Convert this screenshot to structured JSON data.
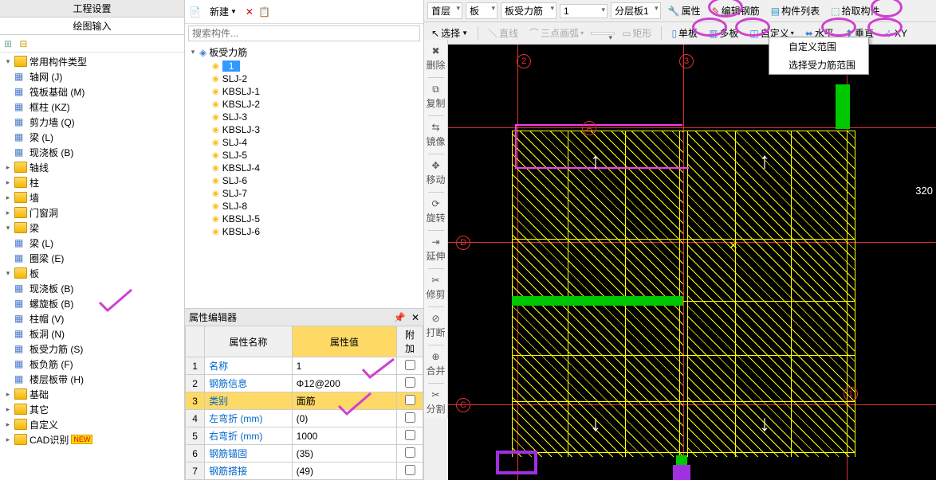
{
  "left_panel": {
    "tabs": {
      "settings": "工程设置",
      "draw": "绘图输入"
    },
    "tree": [
      {
        "label": "常用构件类型",
        "depth": 0,
        "exp": "▾",
        "icon": "folder"
      },
      {
        "label": "轴网 (J)",
        "depth": 1,
        "icon": "grid"
      },
      {
        "label": "筏板基础 (M)",
        "depth": 1,
        "icon": "grid"
      },
      {
        "label": "框柱 (KZ)",
        "depth": 1,
        "icon": "col"
      },
      {
        "label": "剪力墙 (Q)",
        "depth": 1,
        "icon": "wall"
      },
      {
        "label": "梁 (L)",
        "depth": 1,
        "icon": "beam"
      },
      {
        "label": "现浇板 (B)",
        "depth": 1,
        "icon": "slab"
      },
      {
        "label": "轴线",
        "depth": 0,
        "exp": "▸",
        "icon": "folder"
      },
      {
        "label": "柱",
        "depth": 0,
        "exp": "▸",
        "icon": "folder"
      },
      {
        "label": "墙",
        "depth": 0,
        "exp": "▸",
        "icon": "folder"
      },
      {
        "label": "门窗洞",
        "depth": 0,
        "exp": "▸",
        "icon": "folder"
      },
      {
        "label": "梁",
        "depth": 0,
        "exp": "▾",
        "icon": "folder"
      },
      {
        "label": "梁 (L)",
        "depth": 1,
        "icon": "beam"
      },
      {
        "label": "圈梁 (E)",
        "depth": 1,
        "icon": "beam"
      },
      {
        "label": "板",
        "depth": 0,
        "exp": "▾",
        "icon": "folder"
      },
      {
        "label": "现浇板 (B)",
        "depth": 1,
        "icon": "slab"
      },
      {
        "label": "螺旋板 (B)",
        "depth": 1,
        "icon": "slab"
      },
      {
        "label": "柱帽 (V)",
        "depth": 1,
        "icon": "cap"
      },
      {
        "label": "板洞 (N)",
        "depth": 1,
        "icon": "hole"
      },
      {
        "label": "板受力筋 (S)",
        "depth": 1,
        "icon": "rebar",
        "selected": false
      },
      {
        "label": "板负筋 (F)",
        "depth": 1,
        "icon": "rebar"
      },
      {
        "label": "楼层板带 (H)",
        "depth": 1,
        "icon": "strip"
      },
      {
        "label": "基础",
        "depth": 0,
        "exp": "▸",
        "icon": "folder"
      },
      {
        "label": "其它",
        "depth": 0,
        "exp": "▸",
        "icon": "folder"
      },
      {
        "label": "自定义",
        "depth": 0,
        "exp": "▸",
        "icon": "folder"
      },
      {
        "label": "CAD识别",
        "depth": 0,
        "exp": "▸",
        "icon": "folder",
        "badge": "NEW"
      }
    ]
  },
  "mid_panel": {
    "toolbar": {
      "new": "新建"
    },
    "search_placeholder": "搜索构件...",
    "root": "板受力筋",
    "items": [
      "1",
      "SLJ-2",
      "KBSLJ-1",
      "KBSLJ-2",
      "SLJ-3",
      "KBSLJ-3",
      "SLJ-4",
      "SLJ-5",
      "KBSLJ-4",
      "SLJ-6",
      "SLJ-7",
      "SLJ-8",
      "KBSLJ-5",
      "KBSLJ-6"
    ],
    "selected_index": 0
  },
  "prop_panel": {
    "title": "属性编辑器",
    "headers": {
      "name": "属性名称",
      "value": "属性值",
      "add": "附加"
    },
    "rows": [
      {
        "n": "1",
        "name": "名称",
        "value": "1"
      },
      {
        "n": "2",
        "name": "钢筋信息",
        "value": "Φ12@200"
      },
      {
        "n": "3",
        "name": "类别",
        "value": "面筋",
        "sel": true
      },
      {
        "n": "4",
        "name": "左弯折 (mm)",
        "value": "(0)"
      },
      {
        "n": "5",
        "name": "右弯折 (mm)",
        "value": "1000"
      },
      {
        "n": "6",
        "name": "钢筋锚固",
        "value": "(35)"
      },
      {
        "n": "7",
        "name": "钢筋搭接",
        "value": "(49)"
      }
    ]
  },
  "top_toolbar": {
    "floor": "首层",
    "cat": "板",
    "sub": "板受力筋",
    "item": "1",
    "layer": "分层板1",
    "props": "属性",
    "edit_rebar": "编辑钢筋",
    "list": "构件列表",
    "pick": "拾取构件"
  },
  "second_toolbar": {
    "select": "选择",
    "line": "直线",
    "arc": "三点画弧",
    "rect": "矩形",
    "single": "单板",
    "multi": "多板",
    "custom": "自定义",
    "horiz": "水平",
    "vert": "垂直",
    "xy": "XY"
  },
  "dropdown": {
    "opt1": "自定义范围",
    "opt2": "选择受力筋范围"
  },
  "vtoolbar": [
    "删除",
    "复制",
    "镜像",
    "移动",
    "旋转",
    "延伸",
    "修剪",
    "打断",
    "合并",
    "分割"
  ],
  "canvas": {
    "dim": "320",
    "axis": [
      "2",
      "3",
      "A",
      "D",
      "C",
      "1"
    ]
  }
}
